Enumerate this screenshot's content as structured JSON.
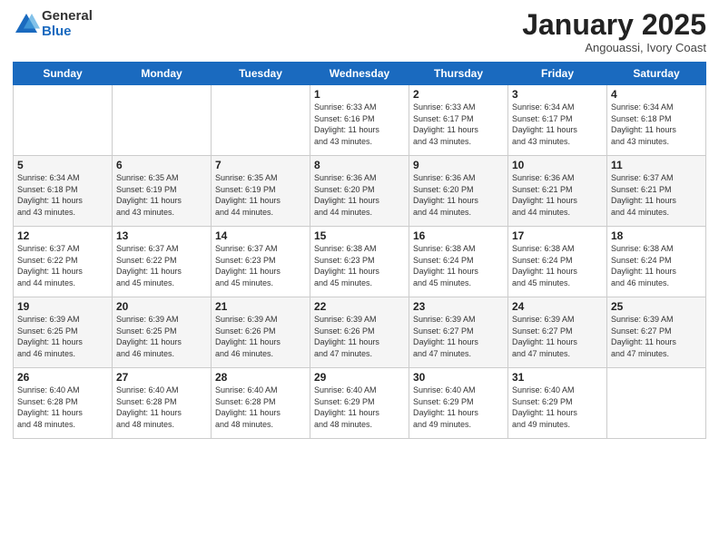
{
  "logo": {
    "general": "General",
    "blue": "Blue"
  },
  "header": {
    "month": "January 2025",
    "location": "Angouassi, Ivory Coast"
  },
  "weekdays": [
    "Sunday",
    "Monday",
    "Tuesday",
    "Wednesday",
    "Thursday",
    "Friday",
    "Saturday"
  ],
  "weeks": [
    [
      {
        "day": "",
        "info": ""
      },
      {
        "day": "",
        "info": ""
      },
      {
        "day": "",
        "info": ""
      },
      {
        "day": "1",
        "info": "Sunrise: 6:33 AM\nSunset: 6:16 PM\nDaylight: 11 hours\nand 43 minutes."
      },
      {
        "day": "2",
        "info": "Sunrise: 6:33 AM\nSunset: 6:17 PM\nDaylight: 11 hours\nand 43 minutes."
      },
      {
        "day": "3",
        "info": "Sunrise: 6:34 AM\nSunset: 6:17 PM\nDaylight: 11 hours\nand 43 minutes."
      },
      {
        "day": "4",
        "info": "Sunrise: 6:34 AM\nSunset: 6:18 PM\nDaylight: 11 hours\nand 43 minutes."
      }
    ],
    [
      {
        "day": "5",
        "info": "Sunrise: 6:34 AM\nSunset: 6:18 PM\nDaylight: 11 hours\nand 43 minutes."
      },
      {
        "day": "6",
        "info": "Sunrise: 6:35 AM\nSunset: 6:19 PM\nDaylight: 11 hours\nand 43 minutes."
      },
      {
        "day": "7",
        "info": "Sunrise: 6:35 AM\nSunset: 6:19 PM\nDaylight: 11 hours\nand 44 minutes."
      },
      {
        "day": "8",
        "info": "Sunrise: 6:36 AM\nSunset: 6:20 PM\nDaylight: 11 hours\nand 44 minutes."
      },
      {
        "day": "9",
        "info": "Sunrise: 6:36 AM\nSunset: 6:20 PM\nDaylight: 11 hours\nand 44 minutes."
      },
      {
        "day": "10",
        "info": "Sunrise: 6:36 AM\nSunset: 6:21 PM\nDaylight: 11 hours\nand 44 minutes."
      },
      {
        "day": "11",
        "info": "Sunrise: 6:37 AM\nSunset: 6:21 PM\nDaylight: 11 hours\nand 44 minutes."
      }
    ],
    [
      {
        "day": "12",
        "info": "Sunrise: 6:37 AM\nSunset: 6:22 PM\nDaylight: 11 hours\nand 44 minutes."
      },
      {
        "day": "13",
        "info": "Sunrise: 6:37 AM\nSunset: 6:22 PM\nDaylight: 11 hours\nand 45 minutes."
      },
      {
        "day": "14",
        "info": "Sunrise: 6:37 AM\nSunset: 6:23 PM\nDaylight: 11 hours\nand 45 minutes."
      },
      {
        "day": "15",
        "info": "Sunrise: 6:38 AM\nSunset: 6:23 PM\nDaylight: 11 hours\nand 45 minutes."
      },
      {
        "day": "16",
        "info": "Sunrise: 6:38 AM\nSunset: 6:24 PM\nDaylight: 11 hours\nand 45 minutes."
      },
      {
        "day": "17",
        "info": "Sunrise: 6:38 AM\nSunset: 6:24 PM\nDaylight: 11 hours\nand 45 minutes."
      },
      {
        "day": "18",
        "info": "Sunrise: 6:38 AM\nSunset: 6:24 PM\nDaylight: 11 hours\nand 46 minutes."
      }
    ],
    [
      {
        "day": "19",
        "info": "Sunrise: 6:39 AM\nSunset: 6:25 PM\nDaylight: 11 hours\nand 46 minutes."
      },
      {
        "day": "20",
        "info": "Sunrise: 6:39 AM\nSunset: 6:25 PM\nDaylight: 11 hours\nand 46 minutes."
      },
      {
        "day": "21",
        "info": "Sunrise: 6:39 AM\nSunset: 6:26 PM\nDaylight: 11 hours\nand 46 minutes."
      },
      {
        "day": "22",
        "info": "Sunrise: 6:39 AM\nSunset: 6:26 PM\nDaylight: 11 hours\nand 47 minutes."
      },
      {
        "day": "23",
        "info": "Sunrise: 6:39 AM\nSunset: 6:27 PM\nDaylight: 11 hours\nand 47 minutes."
      },
      {
        "day": "24",
        "info": "Sunrise: 6:39 AM\nSunset: 6:27 PM\nDaylight: 11 hours\nand 47 minutes."
      },
      {
        "day": "25",
        "info": "Sunrise: 6:39 AM\nSunset: 6:27 PM\nDaylight: 11 hours\nand 47 minutes."
      }
    ],
    [
      {
        "day": "26",
        "info": "Sunrise: 6:40 AM\nSunset: 6:28 PM\nDaylight: 11 hours\nand 48 minutes."
      },
      {
        "day": "27",
        "info": "Sunrise: 6:40 AM\nSunset: 6:28 PM\nDaylight: 11 hours\nand 48 minutes."
      },
      {
        "day": "28",
        "info": "Sunrise: 6:40 AM\nSunset: 6:28 PM\nDaylight: 11 hours\nand 48 minutes."
      },
      {
        "day": "29",
        "info": "Sunrise: 6:40 AM\nSunset: 6:29 PM\nDaylight: 11 hours\nand 48 minutes."
      },
      {
        "day": "30",
        "info": "Sunrise: 6:40 AM\nSunset: 6:29 PM\nDaylight: 11 hours\nand 49 minutes."
      },
      {
        "day": "31",
        "info": "Sunrise: 6:40 AM\nSunset: 6:29 PM\nDaylight: 11 hours\nand 49 minutes."
      },
      {
        "day": "",
        "info": ""
      }
    ]
  ]
}
